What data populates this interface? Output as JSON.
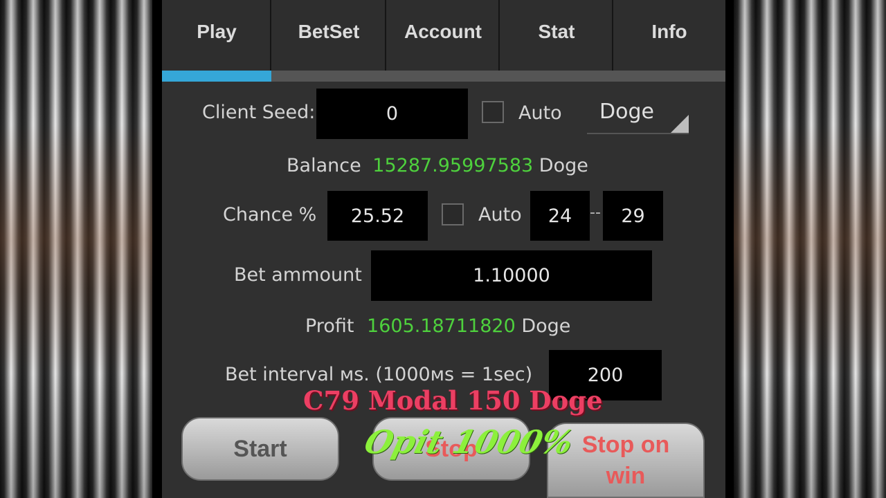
{
  "tabs": [
    {
      "label": "Play",
      "active": true
    },
    {
      "label": "BetSet",
      "active": false
    },
    {
      "label": "Account",
      "active": false
    },
    {
      "label": "Stat",
      "active": false
    },
    {
      "label": "Info",
      "active": false
    }
  ],
  "client_seed": {
    "label": "Client Seed:",
    "value": "0",
    "auto_label": "Auto",
    "auto_checked": false
  },
  "currency": {
    "selected": "Doge"
  },
  "balance": {
    "label": "Balance",
    "value": "15287.95997583",
    "unit": "Doge"
  },
  "chance": {
    "label": "Chance %",
    "value": "25.52",
    "auto_label": "Auto",
    "auto_checked": false,
    "range_min": "24",
    "range_sep": "--",
    "range_max": "29"
  },
  "bet": {
    "label": "Bet ammount",
    "value": "1.10000"
  },
  "profit": {
    "label": "Profit",
    "value": "1605.18711820",
    "unit": "Doge"
  },
  "interval": {
    "label": "Bet interval мs. (1000мs = 1sec)",
    "value": "200"
  },
  "buttons": {
    "start": "Start",
    "stop": "Stop",
    "stop_on_win": "Stop on win"
  },
  "overlay": {
    "title": "C79 Modal 150 Doge",
    "subtitle": "Opit 1000%"
  },
  "colors": {
    "accent": "#35a7d8",
    "value_green": "#4ed13d",
    "overlay_red": "#ec3f63",
    "overlay_green": "#8cf03c"
  }
}
